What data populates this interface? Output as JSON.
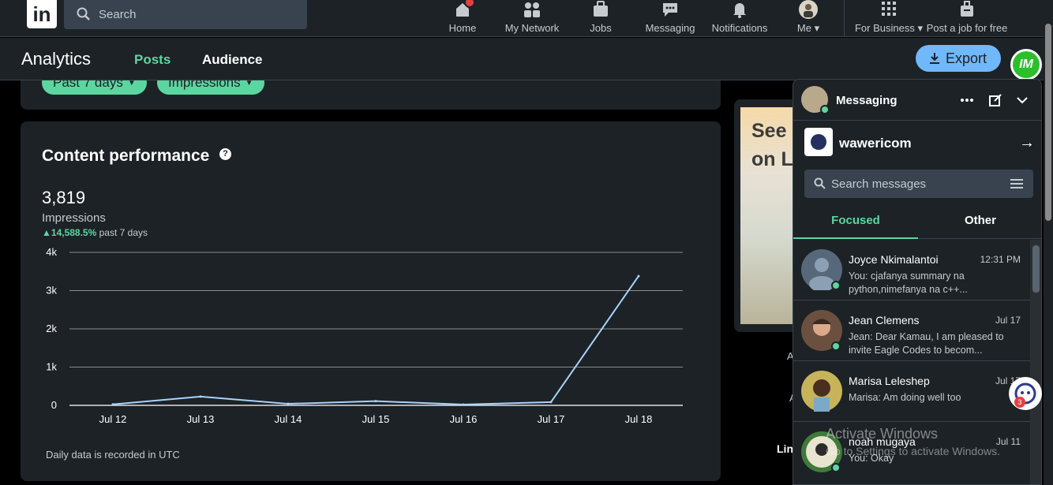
{
  "nav": {
    "logo": "in",
    "search_placeholder": "Search",
    "items": [
      {
        "label": "Home"
      },
      {
        "label": "My Network"
      },
      {
        "label": "Jobs"
      },
      {
        "label": "Messaging"
      },
      {
        "label": "Notifications"
      },
      {
        "label": "Me"
      },
      {
        "label": "For Business"
      },
      {
        "label": "Post a job for free"
      }
    ]
  },
  "subheader": {
    "title": "Analytics",
    "tabs": [
      {
        "label": "Posts"
      },
      {
        "label": "Audience"
      }
    ],
    "export_label": "Export",
    "badge_text": "IM"
  },
  "filters": {
    "period": "Past 7 days",
    "metric": "Impressions"
  },
  "performance": {
    "title": "Content performance",
    "total": "3,819",
    "metric_label": "Impressions",
    "delta": "14,588.5%",
    "delta_period": "past 7 days",
    "footnote": "Daily data is recorded in UTC"
  },
  "chart_data": {
    "type": "line",
    "categories": [
      "Jul 12",
      "Jul 13",
      "Jul 14",
      "Jul 15",
      "Jul 16",
      "Jul 17",
      "Jul 18"
    ],
    "series": [
      {
        "values": [
          25,
          230,
          40,
          110,
          20,
          85,
          3380
        ]
      }
    ],
    "yticks": [
      "0",
      "1k",
      "2k",
      "3k",
      "4k"
    ],
    "ylim": [
      0,
      4000
    ],
    "grid": true,
    "line_color": "#a8d3ff"
  },
  "ad": {
    "line1": "See",
    "line2": "on L"
  },
  "sidebar": {
    "a1": "A",
    "a2": "A",
    "lin": "Lin"
  },
  "messaging": {
    "title": "Messaging",
    "account": "wawericom",
    "search_placeholder": "Search messages",
    "tabs": [
      {
        "label": "Focused"
      },
      {
        "label": "Other"
      }
    ],
    "conversations": [
      {
        "name": "Joyce Nkimalantoi",
        "time": "12:31 PM",
        "snippet": "You: cjafanya summary na python,nimefanya na c++..."
      },
      {
        "name": "Jean Clemens",
        "time": "Jul 17",
        "snippet": "Jean: Dear Kamau, I am pleased to invite Eagle Codes to becom..."
      },
      {
        "name": "Marisa Leleshep",
        "time": "Jul 17",
        "snippet": "Marisa: Am doing well too"
      },
      {
        "name": "noah mugaya",
        "time": "Jul 11",
        "snippet": "You: Okay"
      }
    ]
  },
  "watermark": {
    "line1": "Activate Windows",
    "line2": "Go to Settings to activate Windows."
  },
  "bot_badge": "3",
  "colors": {
    "accent_green": "#5cd6a0",
    "accent_blue": "#71b7fb",
    "bg_card": "#1d2226"
  }
}
